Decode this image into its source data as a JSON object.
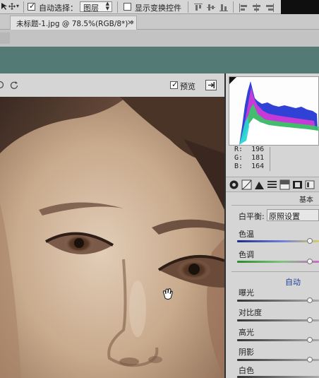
{
  "options_bar": {
    "auto_select_label": "自动选择：",
    "auto_select_checked": true,
    "layer_select_value": "图层",
    "show_transform_label": "显示变换控件",
    "show_transform_checked": false
  },
  "document": {
    "tab_title": "未标题-1.jpg @ 78.5%(RGB/8*) *",
    "close_glyph": "×"
  },
  "dialog": {
    "preview_label": "预览",
    "preview_checked": true
  },
  "readout": {
    "r_label": "R:",
    "r_value": "196",
    "g_label": "G:",
    "g_value": "181",
    "b_label": "B:",
    "b_value": "164"
  },
  "panel": {
    "section_title": "基本",
    "white_balance_label": "白平衡:",
    "white_balance_value": "原照设置",
    "temperature_label": "色温",
    "tint_label": "色调",
    "auto_label": "自动",
    "sliders": [
      {
        "label": "曝光",
        "value": 0
      },
      {
        "label": "对比度",
        "value": 0
      },
      {
        "label": "高光",
        "value": 0
      },
      {
        "label": "阴影",
        "value": 0
      },
      {
        "label": "白色",
        "value": 0
      }
    ]
  },
  "colors": {
    "teal_bar": "#547a76",
    "accent_link": "#1a3f9c",
    "temperature_track_start": "#1f2d8a",
    "tint_track_start": "#2c8a2c"
  }
}
